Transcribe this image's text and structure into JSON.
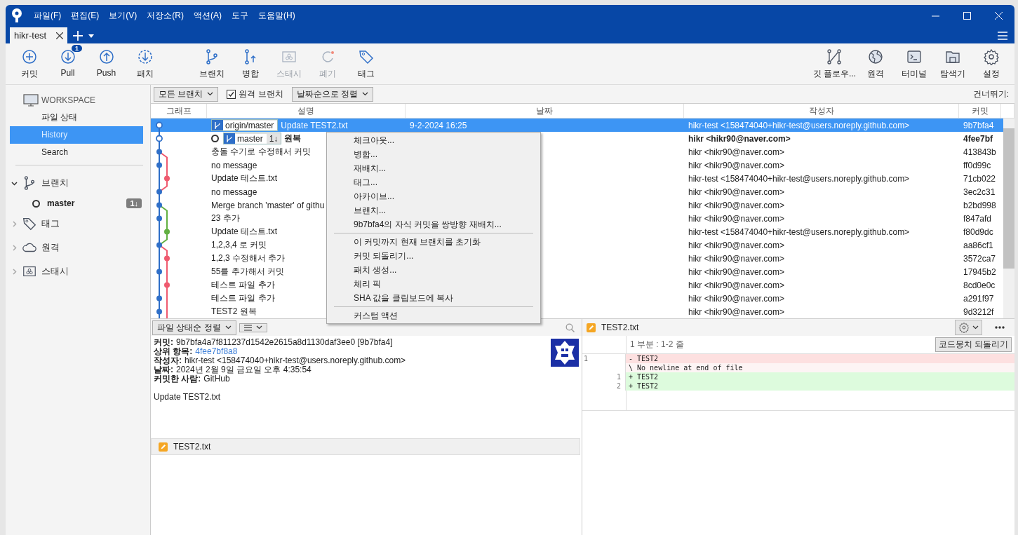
{
  "menu_bar": [
    "파일(F)",
    "편집(E)",
    "보기(V)",
    "저장소(R)",
    "액션(A)",
    "도구",
    "도움말(H)"
  ],
  "tabs": [
    {
      "label": "hikr-test",
      "selected": true
    }
  ],
  "toolbar": {
    "groups": [
      [
        {
          "label": "커밋",
          "kind": "commit",
          "disabled": false
        },
        {
          "label": "Pull",
          "kind": "pull",
          "disabled": false,
          "badge": "1"
        },
        {
          "label": "Push",
          "kind": "push",
          "disabled": false
        },
        {
          "label": "패치",
          "kind": "fetch",
          "disabled": false
        }
      ],
      [
        {
          "label": "브랜치",
          "kind": "branch",
          "disabled": false
        },
        {
          "label": "병합",
          "kind": "merge",
          "disabled": false
        },
        {
          "label": "스태시",
          "kind": "stash",
          "disabled": true
        },
        {
          "label": "폐기",
          "kind": "discard",
          "disabled": true
        },
        {
          "label": "태그",
          "kind": "tag",
          "disabled": false
        }
      ]
    ],
    "right": [
      {
        "label": "깃 플로우...",
        "kind": "flow",
        "disabled": false
      },
      {
        "label": "원격",
        "kind": "globe",
        "disabled": false
      },
      {
        "label": "터미널",
        "kind": "terminal",
        "disabled": false
      },
      {
        "label": "탐색기",
        "kind": "folder",
        "disabled": false
      },
      {
        "label": "설정",
        "kind": "gear",
        "disabled": false
      }
    ]
  },
  "sidebar": {
    "workspace": "WORKSPACE",
    "items": [
      {
        "label": "파일 상태",
        "selected": false
      },
      {
        "label": "History",
        "selected": true
      },
      {
        "label": "Search",
        "selected": false
      }
    ],
    "sections": [
      {
        "label": "브랜치",
        "kind": "branch",
        "expanded": true,
        "children": [
          {
            "label": "master",
            "badge": "1↓"
          }
        ]
      },
      {
        "label": "태그",
        "kind": "tag",
        "expanded": false
      },
      {
        "label": "원격",
        "kind": "cloud",
        "expanded": false
      },
      {
        "label": "스태시",
        "kind": "stash",
        "expanded": false
      }
    ]
  },
  "filter_bar": {
    "branches": "모든 브랜치",
    "remote_branches": {
      "label": "원격 브랜치",
      "checked": true
    },
    "sort": "날짜순으로 정렬",
    "jump": "건너뛰기:"
  },
  "table": {
    "columns": [
      "그래프",
      "설명",
      "날짜",
      "작성자",
      "커밋"
    ],
    "rows": [
      {
        "description": "Update TEST2.txt",
        "refs": [
          {
            "label": "origin/master"
          }
        ],
        "date": "9-2-2024 16:25",
        "author": "hikr-test <158474040+hikr-test@users.noreply.github.com>",
        "commit": "9b7bfa4",
        "selected": true,
        "current": false
      },
      {
        "description": "원복",
        "refs": [
          {
            "label": "master",
            "behind": "1↓"
          }
        ],
        "author": "hikr <hikr90@naver.com>",
        "commit": "4fee7bf",
        "selected": false,
        "current": true
      },
      {
        "description": "충돌 수기로 수정해서 커밋",
        "author": "hikr <hikr90@naver.com>",
        "commit": "413843b",
        "selected": false,
        "current": false
      },
      {
        "description": "no message",
        "author": "hikr <hikr90@naver.com>",
        "commit": "ff0d99c",
        "selected": false,
        "current": false
      },
      {
        "description": "Update 테스트.txt",
        "author": "hikr-test <158474040+hikr-test@users.noreply.github.com>",
        "commit": "71cb022",
        "selected": false,
        "current": false
      },
      {
        "description": "no message",
        "author": "hikr <hikr90@naver.com>",
        "commit": "3ec2c31",
        "selected": false,
        "current": false
      },
      {
        "description": "Merge branch 'master' of githu",
        "author": "hikr <hikr90@naver.com>",
        "commit": "b2bd998",
        "selected": false,
        "current": false
      },
      {
        "description": "23 추가",
        "author": "hikr <hikr90@naver.com>",
        "commit": "f847afd",
        "selected": false,
        "current": false
      },
      {
        "description": "Update 테스트.txt",
        "author": "hikr-test <158474040+hikr-test@users.noreply.github.com>",
        "commit": "f80d9dc",
        "selected": false,
        "current": false
      },
      {
        "description": "1,2,3,4 로 커밋",
        "author": "hikr <hikr90@naver.com>",
        "commit": "aa86cf1",
        "selected": false,
        "current": false
      },
      {
        "description": "1,2,3 수정해서 추가",
        "author": "hikr <hikr90@naver.com>",
        "commit": "3572ca7",
        "selected": false,
        "current": false
      },
      {
        "description": "55를 추가해서 커밋",
        "author": "hikr <hikr90@naver.com>",
        "commit": "17945b2",
        "selected": false,
        "current": false
      },
      {
        "description": "테스트 파일 추가",
        "author": "hikr <hikr90@naver.com>",
        "commit": "8cd0e0c",
        "selected": false,
        "current": false
      },
      {
        "description": "테스트 파일 추가",
        "author": "hikr <hikr90@naver.com>",
        "commit": "a291f97",
        "selected": false,
        "current": false
      },
      {
        "description": "TEST2 원복",
        "author": "hikr <hikr90@naver.com>",
        "commit": "9d3212f",
        "selected": false,
        "current": false
      }
    ]
  },
  "context_menu": {
    "groups": [
      [
        "체크아웃...",
        "병합...",
        "재배치...",
        "태그...",
        "아카이브...",
        "브랜치...",
        "9b7bfa4의 자식 커밋을 쌍방향 재배치..."
      ],
      [
        "이 커밋까지 현재 브랜치를 초기화",
        "커밋 되돌리기...",
        "패치 생성...",
        "체리 픽",
        "SHA 값을 클립보드에 복사"
      ],
      [
        "커스텀 액션"
      ]
    ]
  },
  "details": {
    "sort": "파일 상태순 정렬",
    "fields": [
      {
        "label": "커밋:",
        "value": "9b7bfa4a7f811237d1542e2615a8d1130daf3ee0 [9b7bfa4]",
        "kind": "text"
      },
      {
        "label": "상위 항목:",
        "value": "4fee7bf8a8",
        "kind": "link"
      },
      {
        "label": "작성자:",
        "value": "hikr-test <158474040+hikr-test@users.noreply.github.com>",
        "kind": "text"
      },
      {
        "label": "날짜:",
        "value": "2024년 2월 9일 금요일 오후 4:35:54",
        "kind": "text"
      },
      {
        "label": "커밋한 사람:",
        "value": "GitHub",
        "kind": "text"
      }
    ],
    "message": "Update TEST2.txt",
    "files": [
      "TEST2.txt"
    ]
  },
  "diff": {
    "file": "TEST2.txt",
    "hunk": "1 부분 : 1-2 줄",
    "discard_hunk": "코드뭉치 되돌리기",
    "lines": [
      {
        "kind": "removed",
        "old": "1",
        "text": "- TEST2"
      },
      {
        "kind": "note",
        "text": "\\ No newline at end of file"
      },
      {
        "kind": "added",
        "new": "1",
        "text": "+ TEST2"
      },
      {
        "kind": "added",
        "new": "2",
        "text": "+ TEST2"
      }
    ]
  }
}
